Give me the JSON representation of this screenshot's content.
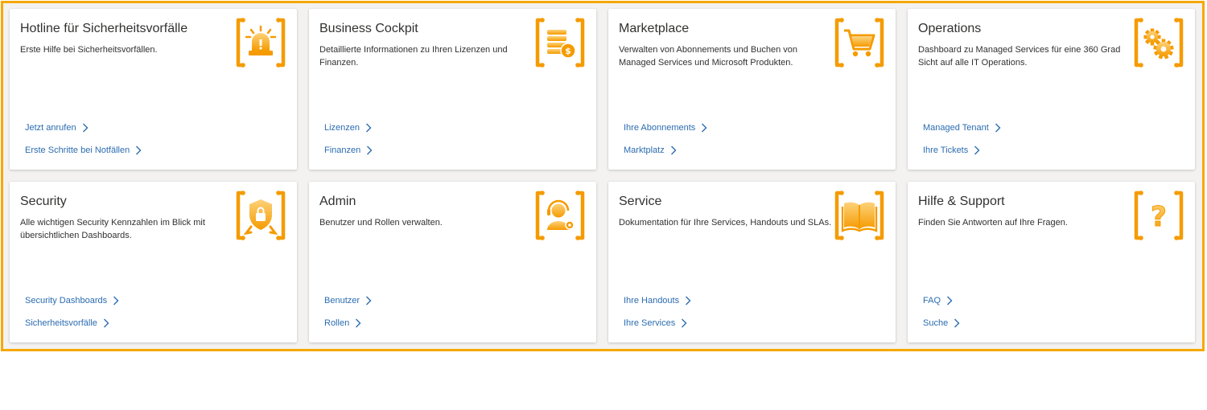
{
  "cards": [
    {
      "title": "Hotline für Sicherheitsvorfälle",
      "description": "Erste Hilfe bei Sicherheitsvorfällen.",
      "icon": "alarm-siren-icon",
      "links": [
        "Jetzt anrufen",
        "Erste Schritte bei Notfällen"
      ]
    },
    {
      "title": "Business Cockpit",
      "description": "Detaillierte Informationen zu Ihren Lizenzen und Finanzen.",
      "icon": "coins-icon",
      "links": [
        "Lizenzen",
        "Finanzen"
      ]
    },
    {
      "title": "Marketplace",
      "description": "Verwalten von Abonnements und Buchen von Managed Services und Microsoft Produkten.",
      "icon": "shopping-cart-icon",
      "links": [
        "Ihre Abonnements",
        "Marktplatz"
      ]
    },
    {
      "title": "Operations",
      "description": "Dashboard zu Managed Services für eine 360 Grad Sicht auf alle IT Operations.",
      "icon": "gears-icon",
      "links": [
        "Managed Tenant",
        "Ihre Tickets"
      ]
    },
    {
      "title": "Security",
      "description": "Alle wichtigen Security Kennzahlen im Blick mit übersichtlichen Dashboards.",
      "icon": "shield-lock-icon",
      "links": [
        "Security Dashboards",
        "Sicherheitsvorfälle"
      ]
    },
    {
      "title": "Admin",
      "description": "Benutzer und Rollen verwalten.",
      "icon": "user-headset-icon",
      "links": [
        "Benutzer",
        "Rollen"
      ]
    },
    {
      "title": "Service",
      "description": "Dokumentation für Ihre Services, Handouts und SLAs.",
      "icon": "open-book-icon",
      "links": [
        "Ihre Handouts",
        "Ihre Services"
      ]
    },
    {
      "title": "Hilfe & Support",
      "description": "Finden Sie Antworten auf Ihre Fragen.",
      "icon": "question-mark-icon",
      "links": [
        "FAQ",
        "Suche"
      ]
    }
  ],
  "colors": {
    "accent": "#f6a800",
    "icon_orange": "#f59b00",
    "icon_light": "#fdd27a",
    "link": "#2b6cb0",
    "frame_bg": "#f3f2f1"
  }
}
